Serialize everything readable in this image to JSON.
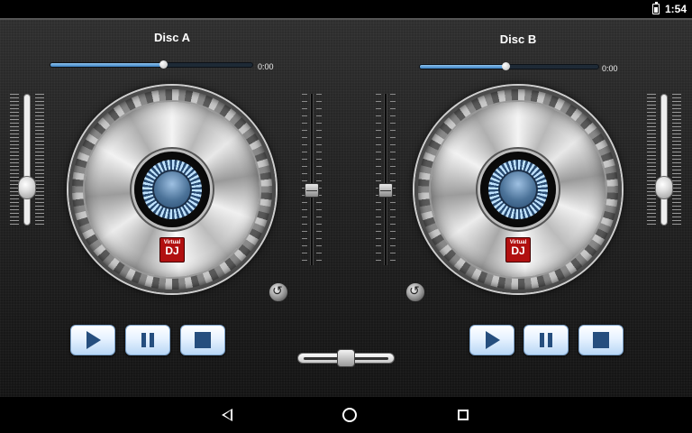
{
  "status_bar": {
    "time": "1:54",
    "battery_icon": "battery-charging-icon"
  },
  "deck_a": {
    "title": "Disc A",
    "progress_time": "0:00",
    "progress_fraction": 0.56,
    "volume_level": 0.24,
    "pitch_level": 0.43,
    "logo": {
      "line1": "Virtual",
      "line2": "DJ"
    },
    "transport": {
      "play_icon": "play-icon",
      "pause_icon": "pause-icon",
      "stop_icon": "stop-icon"
    }
  },
  "deck_b": {
    "title": "Disc B",
    "progress_time": "0:00",
    "progress_fraction": 0.48,
    "volume_level": 0.24,
    "pitch_level": 0.43,
    "logo": {
      "line1": "Virtual",
      "line2": "DJ"
    },
    "transport": {
      "play_icon": "play-icon",
      "pause_icon": "pause-icon",
      "stop_icon": "stop-icon"
    }
  },
  "crossfader": {
    "position": 0.5
  },
  "nav_bar": {
    "back_icon": "back-icon",
    "home_icon": "home-icon",
    "recent_icon": "recent-apps-icon"
  },
  "colors": {
    "accent_blue": "#3b7fc0",
    "button_icon": "#254e7e",
    "logo_red": "#b11010"
  }
}
